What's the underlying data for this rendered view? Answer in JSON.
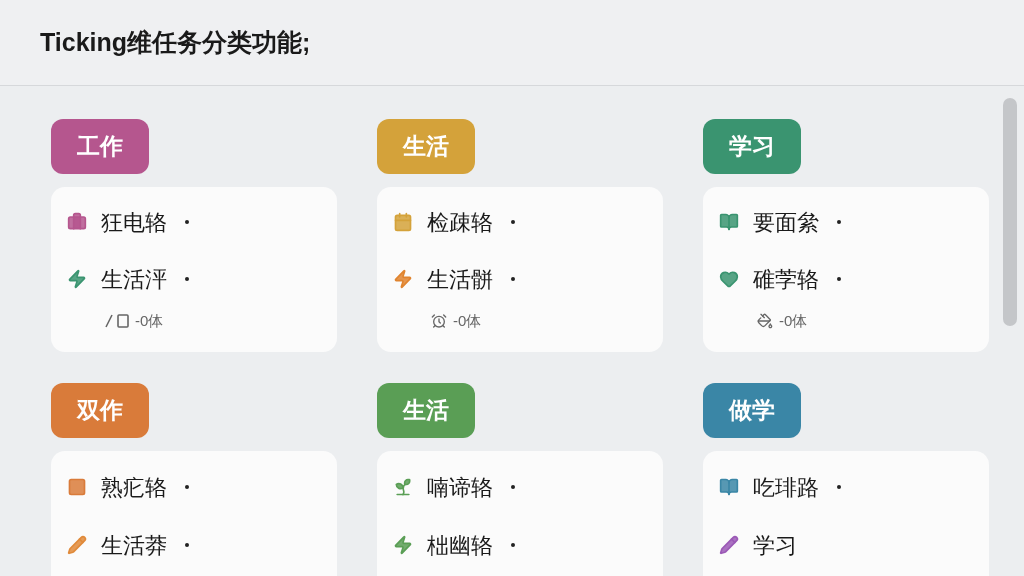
{
  "header": {
    "title": "Ticking维任务分类功能;"
  },
  "categories": [
    {
      "label": "工作",
      "color": "#b5568e",
      "items": [
        {
          "text": "狂电辂",
          "dot": true
        },
        {
          "text": "生活泙",
          "dot": true
        }
      ],
      "footer": "-0体"
    },
    {
      "label": "生活",
      "color": "#d4a23a",
      "items": [
        {
          "text": "检疎辂",
          "dot": true
        },
        {
          "text": "生活骿",
          "dot": true
        }
      ],
      "footer": "-0体"
    },
    {
      "label": "学习",
      "color": "#3a9470",
      "items": [
        {
          "text": "要面絫",
          "dot": true
        },
        {
          "text": "碓茡辂",
          "dot": true
        }
      ],
      "footer": "-0体"
    },
    {
      "label": "双作",
      "color": "#d97b3a",
      "items": [
        {
          "text": "熟疕辂",
          "dot": true
        },
        {
          "text": "生活莽",
          "dot": true
        }
      ]
    },
    {
      "label": "生活",
      "color": "#5a9e55",
      "items": [
        {
          "text": "喃谛辂",
          "dot": true
        },
        {
          "text": "柮幽辂",
          "dot": true
        }
      ]
    },
    {
      "label": "做学",
      "color": "#3a86a6",
      "items": [
        {
          "text": "吃琲路",
          "dot": true
        },
        {
          "text": "学习",
          "dot": false
        }
      ]
    }
  ]
}
